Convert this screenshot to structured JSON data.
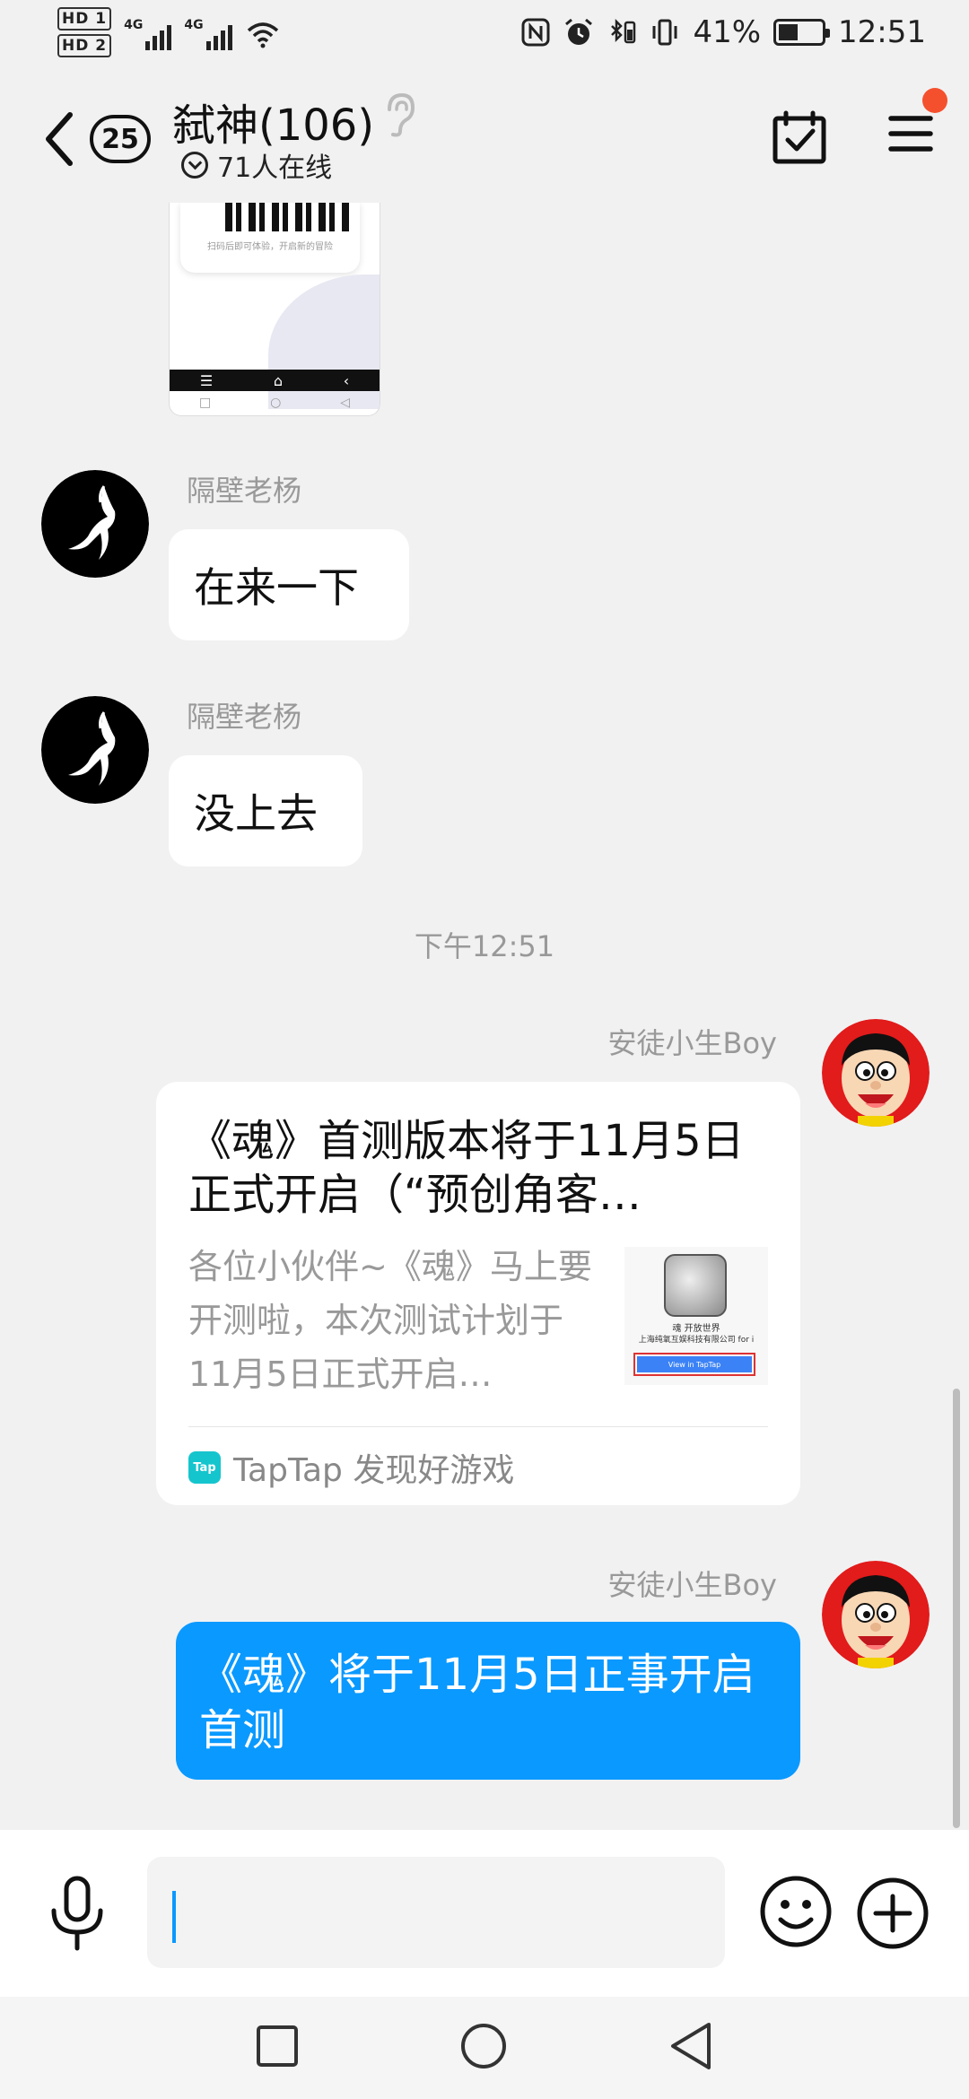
{
  "status_bar": {
    "sim1": "HD 1",
    "sim2": "HD 2",
    "net1": "4G",
    "net2": "4G",
    "battery": "41%",
    "time": "12:51"
  },
  "header": {
    "unread_count": "25",
    "group_name": "弑神(106)",
    "online_text": "71人在线",
    "icons": [
      "back-icon",
      "ear-icon",
      "calendar-check-icon",
      "menu-icon"
    ],
    "notification_dot_color": "#f5502d"
  },
  "shared_image": {
    "caption": "扫码后即可体验，开启新的冒险"
  },
  "messages": [
    {
      "sender": "隔壁老杨",
      "text": "在来一下"
    },
    {
      "sender": "隔壁老杨",
      "text": "没上去"
    }
  ],
  "timestamp": "下午12:51",
  "link_card": {
    "sender": "安徒小生Boy",
    "title": "《魂》首测版本将于11月5日正式开启（“预创角客…",
    "description": "各位小伙伴~《魂》马上要开测啦，本次测试计划于11月5日正式开启…",
    "thumb_title": "魂 开放世界",
    "thumb_company": "上海纯氧互娱科技有限公司 for i",
    "thumb_button": "View in TapTap",
    "source_logo": "Tap",
    "source": "TapTap 发现好游戏"
  },
  "own_message": {
    "sender": "安徒小生Boy",
    "text": "《魂》将于11月5日正事开启首测",
    "bubble_color": "#0a99ff"
  },
  "input": {
    "value": "",
    "icons": [
      "mic-icon",
      "emoji-icon",
      "plus-icon"
    ]
  },
  "nav": {
    "icons": [
      "recents-square-icon",
      "home-circle-icon",
      "back-triangle-icon"
    ]
  }
}
